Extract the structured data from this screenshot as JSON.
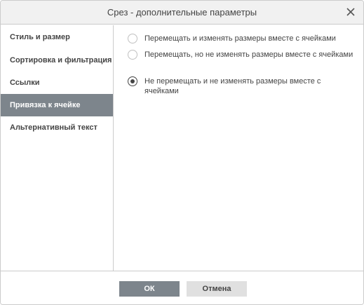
{
  "dialog": {
    "title": "Срез - дополнительные параметры",
    "close_icon": "close-icon"
  },
  "sidebar": {
    "items": [
      {
        "label": "Стиль и размер",
        "active": false
      },
      {
        "label": "Сортировка и фильтрация",
        "active": false
      },
      {
        "label": "Ссылки",
        "active": false
      },
      {
        "label": "Привязка к ячейке",
        "active": true
      },
      {
        "label": "Альтернативный текст",
        "active": false
      }
    ]
  },
  "options": [
    {
      "label": "Перемещать и изменять размеры вместе с ячейками",
      "checked": false
    },
    {
      "label": "Перемещать, но не изменять размеры вместе с ячейками",
      "checked": false
    },
    {
      "label": "Не перемещать и не изменять размеры вместе с ячейками",
      "checked": true
    }
  ],
  "footer": {
    "ok_label": "ОК",
    "cancel_label": "Отмена"
  },
  "colors": {
    "active_nav": "#7d858c",
    "title_bar": "#f1f1f1",
    "border": "#cbcbcb",
    "text": "#444444"
  }
}
